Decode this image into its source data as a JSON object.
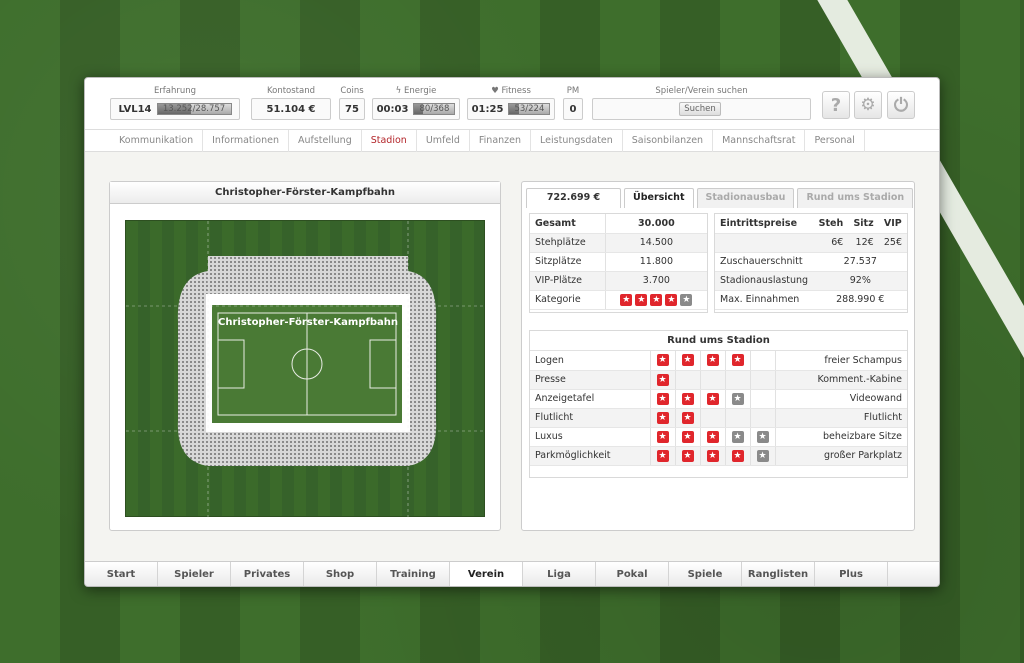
{
  "header": {
    "erfahrung": {
      "label": "Erfahrung",
      "level": "LVL14",
      "value": "13.252/28.757",
      "fraction": 0.46
    },
    "kontostand": {
      "label": "Kontostand",
      "value": "51.104 €"
    },
    "coins": {
      "label": "Coins",
      "value": "75"
    },
    "energie": {
      "label": "Energie",
      "time": "00:03",
      "value": "80/368",
      "fraction": 0.22
    },
    "fitness": {
      "label": "Fitness",
      "time": "01:25",
      "value": "53/224",
      "fraction": 0.24
    },
    "pm": {
      "label": "PM",
      "value": "0"
    },
    "search": {
      "label": "Spieler/Verein suchen",
      "button": "Suchen"
    }
  },
  "subnav": [
    "Kommunikation",
    "Informationen",
    "Aufstellung",
    "Stadion",
    "Umfeld",
    "Finanzen",
    "Leistungsdaten",
    "Saisonbilanzen",
    "Mannschaftsrat",
    "Personal"
  ],
  "subnav_active": "Stadion",
  "stadium": {
    "name": "Christopher-Förster-Kampfbahn",
    "pitch_label": "Christopher-Förster-Kampfbahn"
  },
  "tabs": {
    "money": "722.699 €",
    "overview": "Übersicht",
    "ausbau": "Stadionausbau",
    "rund": "Rund ums Stadion"
  },
  "capacity": {
    "rows": [
      {
        "label": "Gesamt",
        "value": "30.000"
      },
      {
        "label": "Stehplätze",
        "value": "14.500"
      },
      {
        "label": "Sitzplätze",
        "value": "11.800"
      },
      {
        "label": "VIP-Plätze",
        "value": "3.700"
      },
      {
        "label": "Kategorie",
        "stars_red": 4,
        "stars_grey": 1
      }
    ]
  },
  "prices": {
    "header": {
      "label": "Eintrittspreise",
      "steh": "Steh",
      "sitz": "Sitz",
      "vip": "VIP"
    },
    "price_row": {
      "steh": "6€",
      "sitz": "12€",
      "vip": "25€"
    },
    "rows": [
      {
        "label": "Zuschauerschnitt",
        "value": "27.537"
      },
      {
        "label": "Stadionauslastung",
        "value": "92%"
      },
      {
        "label": "Max. Einnahmen",
        "value": "288.990 €"
      }
    ]
  },
  "rund": {
    "title": "Rund ums Stadion",
    "rows": [
      {
        "label": "Logen",
        "stars": [
          "red",
          "red",
          "red",
          "red",
          ""
        ],
        "desc": "freier Schampus"
      },
      {
        "label": "Presse",
        "stars": [
          "red",
          "",
          "",
          "",
          ""
        ],
        "desc": "Komment.-Kabine"
      },
      {
        "label": "Anzeigetafel",
        "stars": [
          "red",
          "red",
          "red",
          "grey",
          ""
        ],
        "desc": "Videowand"
      },
      {
        "label": "Flutlicht",
        "stars": [
          "red",
          "red",
          "",
          "",
          ""
        ],
        "desc": "Flutlicht"
      },
      {
        "label": "Luxus",
        "stars": [
          "red",
          "red",
          "red",
          "grey",
          "grey"
        ],
        "desc": "beheizbare Sitze"
      },
      {
        "label": "Parkmöglichkeit",
        "stars": [
          "red",
          "red",
          "red",
          "red",
          "grey"
        ],
        "desc": "großer Parkplatz"
      }
    ]
  },
  "bottomnav": [
    "Start",
    "Spieler",
    "Privates",
    "Shop",
    "Training",
    "Verein",
    "Liga",
    "Pokal",
    "Spiele",
    "Ranglisten",
    "Plus"
  ],
  "bottomnav_active": "Verein",
  "icons": {
    "help": "help-icon",
    "settings": "gear-icon",
    "power": "power-icon"
  }
}
